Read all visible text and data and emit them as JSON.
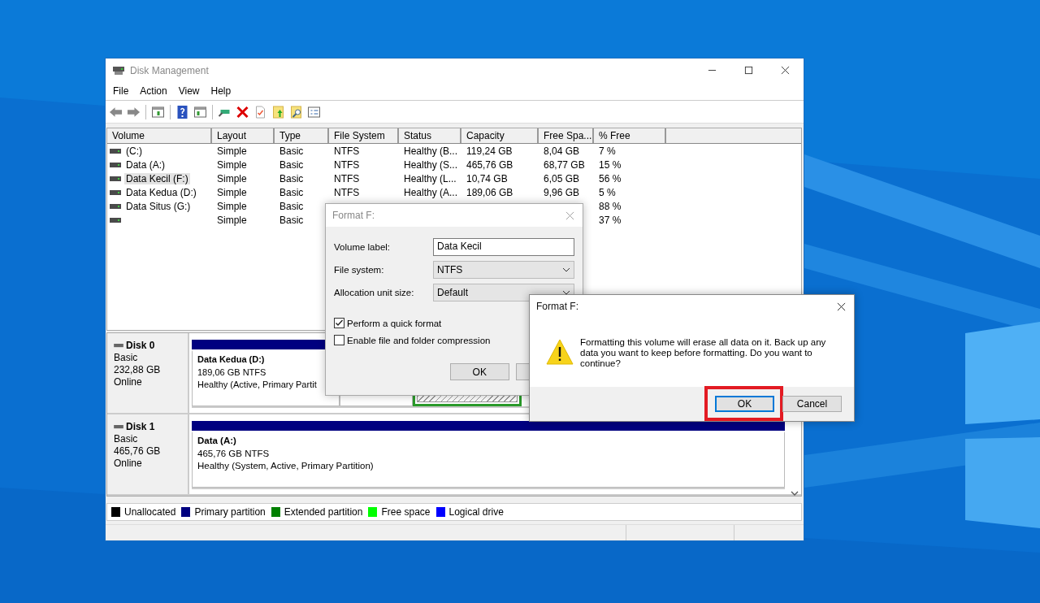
{
  "window": {
    "title": "Disk Management"
  },
  "menu": [
    "File",
    "Action",
    "View",
    "Help"
  ],
  "table": {
    "columns": [
      "Volume",
      "Layout",
      "Type",
      "File System",
      "Status",
      "Capacity",
      "Free Spa...",
      "% Free"
    ],
    "rows": [
      {
        "selected": false,
        "cells": {
          "volume": "(C:)",
          "layout": "Simple",
          "type": "Basic",
          "fs": "NTFS",
          "status": "Healthy (B...",
          "capacity": "119,24 GB",
          "free": "8,04 GB",
          "pct": "7 %"
        }
      },
      {
        "selected": false,
        "cells": {
          "volume": "Data (A:)",
          "layout": "Simple",
          "type": "Basic",
          "fs": "NTFS",
          "status": "Healthy (S...",
          "capacity": "465,76 GB",
          "free": "68,77 GB",
          "pct": "15 %"
        }
      },
      {
        "selected": true,
        "cells": {
          "volume": "Data Kecil (F:)",
          "layout": "Simple",
          "type": "Basic",
          "fs": "NTFS",
          "status": "Healthy (L...",
          "capacity": "10,74 GB",
          "free": "6,05 GB",
          "pct": "56 %"
        }
      },
      {
        "selected": false,
        "cells": {
          "volume": "Data Kedua (D:)",
          "layout": "Simple",
          "type": "Basic",
          "fs": "NTFS",
          "status": "Healthy (A...",
          "capacity": "189,06 GB",
          "free": "9,96 GB",
          "pct": "5 %"
        }
      },
      {
        "selected": false,
        "cells": {
          "volume": "Data Situs (G:)",
          "layout": "Simple",
          "type": "Basic",
          "pct": "88 %"
        }
      },
      {
        "selected": false,
        "cells": {
          "layout": "Simple",
          "type": "Basic",
          "pct": "37 %"
        }
      }
    ]
  },
  "disks": [
    {
      "name": "Disk 0",
      "type": "Basic",
      "size": "232,88 GB",
      "status": "Online",
      "partitions": [
        {
          "kind": "volume",
          "name": "Data Kedua  (D:)",
          "size": "189,06 GB NTFS",
          "status": "Healthy (Active, Primary Partit"
        },
        {
          "kind": "blank"
        },
        {
          "kind": "free"
        }
      ]
    },
    {
      "name": "Disk 1",
      "type": "Basic",
      "size": "465,76 GB",
      "status": "Online",
      "partitions": [
        {
          "kind": "volume",
          "name": "Data  (A:)",
          "size": "465,76 GB NTFS",
          "status": "Healthy (System, Active, Primary Partition)"
        }
      ]
    }
  ],
  "legend": [
    {
      "label": "Unallocated",
      "color": "#000000"
    },
    {
      "label": "Primary partition",
      "color": "#000080"
    },
    {
      "label": "Extended partition",
      "color": "#008000"
    },
    {
      "label": "Free space",
      "color": "#00ff00"
    },
    {
      "label": "Logical drive",
      "color": "#0000ff"
    }
  ],
  "format_dialog": {
    "title": "Format F:",
    "active": false,
    "fields": [
      {
        "kind": "text",
        "label": "Volume label:",
        "value": "Data Kecil"
      },
      {
        "kind": "select",
        "label": "File system:",
        "value": "NTFS"
      },
      {
        "kind": "select",
        "label": "Allocation unit size:",
        "value": "Default"
      }
    ],
    "options": [
      {
        "label": "Perform a quick format",
        "checked": true
      },
      {
        "label": "Enable file and folder compression",
        "checked": false
      }
    ],
    "buttons": [
      {
        "label": "OK"
      }
    ]
  },
  "confirm_dialog": {
    "title": "Format F:",
    "message": "Formatting this volume will erase all data on it. Back up any data you want to keep before formatting. Do you want to continue?",
    "buttons": [
      {
        "label": "OK",
        "focused": true,
        "highlighted": true
      },
      {
        "label": "Cancel",
        "focused": false,
        "highlighted": false
      }
    ]
  }
}
